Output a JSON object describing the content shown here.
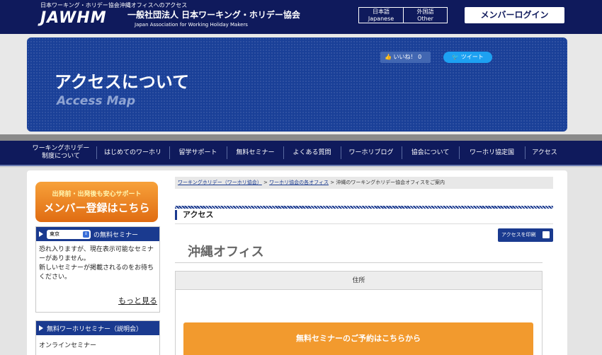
{
  "header": {
    "tagline": "日本ワーキング・ホリデー協会沖縄オフィスへのアクセス",
    "logo": "JAWHM",
    "org_name_jp": "一般社団法人 日本ワーキング・ホリデー協会",
    "org_name_en": "Japan Association for Working Holiday Makers",
    "lang_jp_top": "日本語",
    "lang_jp_bottom": "Japanese",
    "lang_other_top": "外国語",
    "lang_other_bottom": "Other",
    "login_label": "メンバーログイン"
  },
  "banner": {
    "title": "アクセスについて",
    "subtitle": "Access Map",
    "like_label": "いいね！",
    "like_count": "0",
    "tweet_label": "ツイート"
  },
  "nav": {
    "items": [
      "ワーキングホリデー\n制度について",
      "はじめてのワーホリ",
      "留学サポート",
      "無料セミナー",
      "よくある質問",
      "ワーホリブログ",
      "協会について",
      "ワーホリ協定国",
      "アクセス"
    ]
  },
  "sidebar": {
    "register_top": "出発前・出発後も安心サポート",
    "register_main": "メンバー登録はこちら",
    "seminar_select": "東京",
    "seminar_head_suffix": "の無料セミナー",
    "seminar_text": "恐れ入りますが、現在表示可能なセミナーがありません。\n新しいセミナーが掲載されるのをお待ちください。",
    "more_label": "もっと見る",
    "explain_head": "無料ワーホリセミナー（説明会）",
    "online_label": "オンラインセミナー"
  },
  "breadcrumb": {
    "item1": "ワーキングホリデー（ワーホリ協会）",
    "item2": "ワーホリ協会の各オフィス",
    "current": "沖縄のワーキングホリデー協会オフィスをご案内",
    "sep": ">"
  },
  "main": {
    "section_title": "アクセス",
    "print_label": "アクセスを印刷",
    "office_title": "沖縄オフィス",
    "address_header": "住所",
    "cta_label": "無料セミナーのご予約はこちらから"
  }
}
